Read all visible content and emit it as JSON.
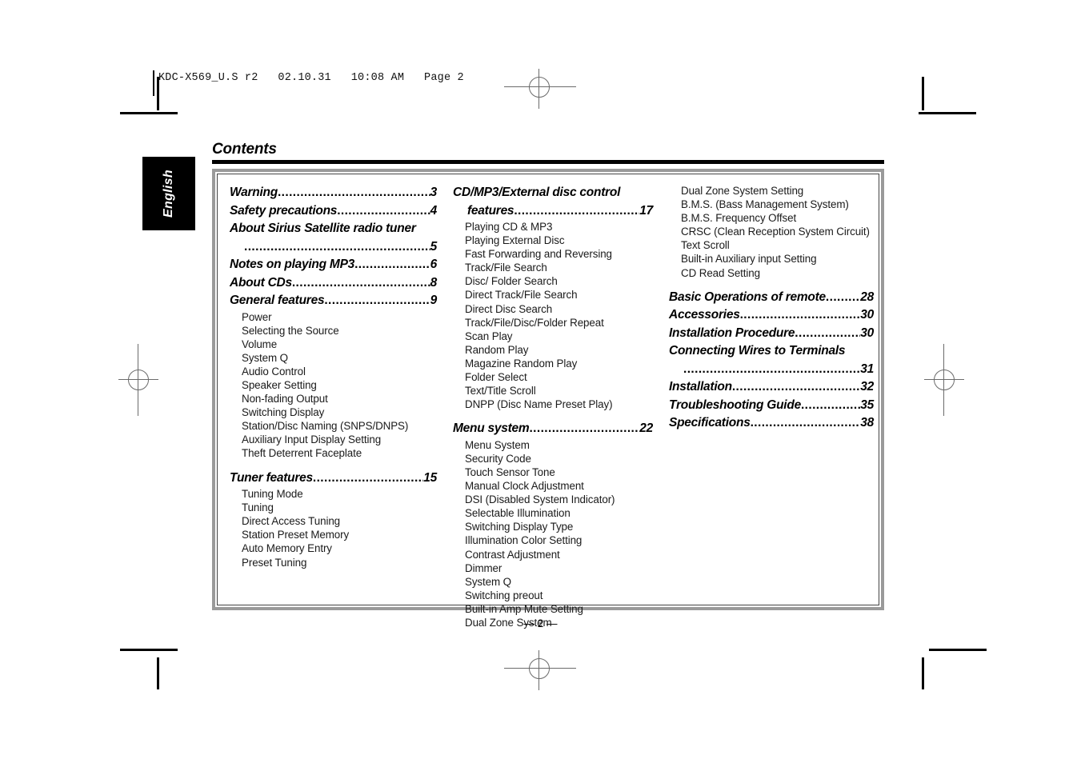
{
  "print_slug": "KDC-X569_U.S r2   02.10.31   10:08 AM   Page 2",
  "page_title": "Contents",
  "language_tab": "English",
  "folio": "— 2 —",
  "leader_dots": "..................................................................................",
  "columns": {
    "left": [
      {
        "kind": "heading",
        "text": "Warning",
        "page": "3"
      },
      {
        "kind": "heading",
        "text": "Safety precautions",
        "page": "4",
        "tight": true
      },
      {
        "kind": "heading_wrap",
        "text": "About Sirius Satellite radio tuner",
        "page": "5"
      },
      {
        "kind": "heading",
        "text": "Notes on playing MP3",
        "page": "6"
      },
      {
        "kind": "heading",
        "text": "About CDs",
        "page": "8",
        "tight": true
      },
      {
        "kind": "heading",
        "text": "General features",
        "page": "9"
      },
      {
        "kind": "sub",
        "text": "Power"
      },
      {
        "kind": "sub",
        "text": "Selecting the Source"
      },
      {
        "kind": "sub",
        "text": "Volume"
      },
      {
        "kind": "sub",
        "text": "System Q"
      },
      {
        "kind": "sub",
        "text": "Audio Control"
      },
      {
        "kind": "sub",
        "text": "Speaker Setting"
      },
      {
        "kind": "sub",
        "text": "Non-fading Output"
      },
      {
        "kind": "sub",
        "text": "Switching Display"
      },
      {
        "kind": "sub",
        "text": "Station/Disc Naming (SNPS/DNPS)"
      },
      {
        "kind": "sub",
        "text": "Auxiliary Input Display Setting"
      },
      {
        "kind": "sub",
        "text": "Theft Deterrent Faceplate"
      },
      {
        "kind": "gap"
      },
      {
        "kind": "heading",
        "text": "Tuner features",
        "page": "15",
        "tight": true
      },
      {
        "kind": "sub",
        "text": "Tuning Mode"
      },
      {
        "kind": "sub",
        "text": "Tuning"
      },
      {
        "kind": "sub",
        "text": "Direct Access Tuning"
      },
      {
        "kind": "sub",
        "text": "Station Preset Memory"
      },
      {
        "kind": "sub",
        "text": "Auto Memory Entry"
      },
      {
        "kind": "sub",
        "text": "Preset Tuning"
      }
    ],
    "middle": [
      {
        "kind": "heading_plain",
        "text": "CD/MP3/External disc control"
      },
      {
        "kind": "heading_cont",
        "text": "features",
        "page": "17"
      },
      {
        "kind": "sub",
        "text": "Playing CD & MP3"
      },
      {
        "kind": "sub",
        "text": "Playing External Disc"
      },
      {
        "kind": "sub",
        "text": "Fast Forwarding and Reversing"
      },
      {
        "kind": "sub",
        "text": "Track/File Search"
      },
      {
        "kind": "sub",
        "text": "Disc/ Folder Search"
      },
      {
        "kind": "sub",
        "text": "Direct Track/File Search"
      },
      {
        "kind": "sub",
        "text": "Direct Disc Search"
      },
      {
        "kind": "sub",
        "text": "Track/File/Disc/Folder Repeat"
      },
      {
        "kind": "sub",
        "text": "Scan Play"
      },
      {
        "kind": "sub",
        "text": "Random Play"
      },
      {
        "kind": "sub",
        "text": "Magazine Random Play"
      },
      {
        "kind": "sub",
        "text": "Folder Select"
      },
      {
        "kind": "sub",
        "text": "Text/Title Scroll"
      },
      {
        "kind": "sub",
        "text": "DNPP (Disc Name Preset Play)"
      },
      {
        "kind": "gap"
      },
      {
        "kind": "heading",
        "text": "Menu system",
        "page": "22",
        "tight": true
      },
      {
        "kind": "sub",
        "text": "Menu System"
      },
      {
        "kind": "sub",
        "text": "Security Code"
      },
      {
        "kind": "sub",
        "text": "Touch Sensor Tone"
      },
      {
        "kind": "sub",
        "text": "Manual Clock Adjustment"
      },
      {
        "kind": "sub",
        "text": "DSI (Disabled System Indicator)"
      },
      {
        "kind": "sub",
        "text": "Selectable Illumination"
      },
      {
        "kind": "sub",
        "text": "Switching Display Type"
      },
      {
        "kind": "sub",
        "text": "Illumination Color Setting"
      },
      {
        "kind": "sub",
        "text": "Contrast Adjustment"
      },
      {
        "kind": "sub",
        "text": "Dimmer"
      },
      {
        "kind": "sub",
        "text": "System Q"
      },
      {
        "kind": "sub",
        "text": "Switching preout"
      },
      {
        "kind": "sub",
        "text": "Built-in Amp Mute Setting"
      },
      {
        "kind": "sub",
        "text": "Dual Zone System"
      }
    ],
    "right": [
      {
        "kind": "sub",
        "text": "Dual Zone System Setting"
      },
      {
        "kind": "sub",
        "text": "B.M.S. (Bass Management System)"
      },
      {
        "kind": "sub",
        "text": "B.M.S. Frequency Offset"
      },
      {
        "kind": "sub",
        "text": "CRSC (Clean Reception System Circuit)"
      },
      {
        "kind": "sub",
        "text": "Text Scroll"
      },
      {
        "kind": "sub",
        "text": "Built-in Auxiliary input Setting"
      },
      {
        "kind": "sub",
        "text": "CD Read Setting"
      },
      {
        "kind": "gap"
      },
      {
        "kind": "heading",
        "text": "Basic Operations of remote",
        "page": "28",
        "tight": true
      },
      {
        "kind": "heading",
        "text": "Accessories",
        "page": "30",
        "tight": true
      },
      {
        "kind": "heading",
        "text": "Installation Procedure",
        "page": "30"
      },
      {
        "kind": "heading_wrap",
        "text": "Connecting Wires to Terminals",
        "page": "31"
      },
      {
        "kind": "heading",
        "text": "Installation",
        "page": "32"
      },
      {
        "kind": "heading",
        "text": "Troubleshooting Guide",
        "page": "35"
      },
      {
        "kind": "heading",
        "text": "Specifications",
        "page": "38"
      }
    ]
  }
}
